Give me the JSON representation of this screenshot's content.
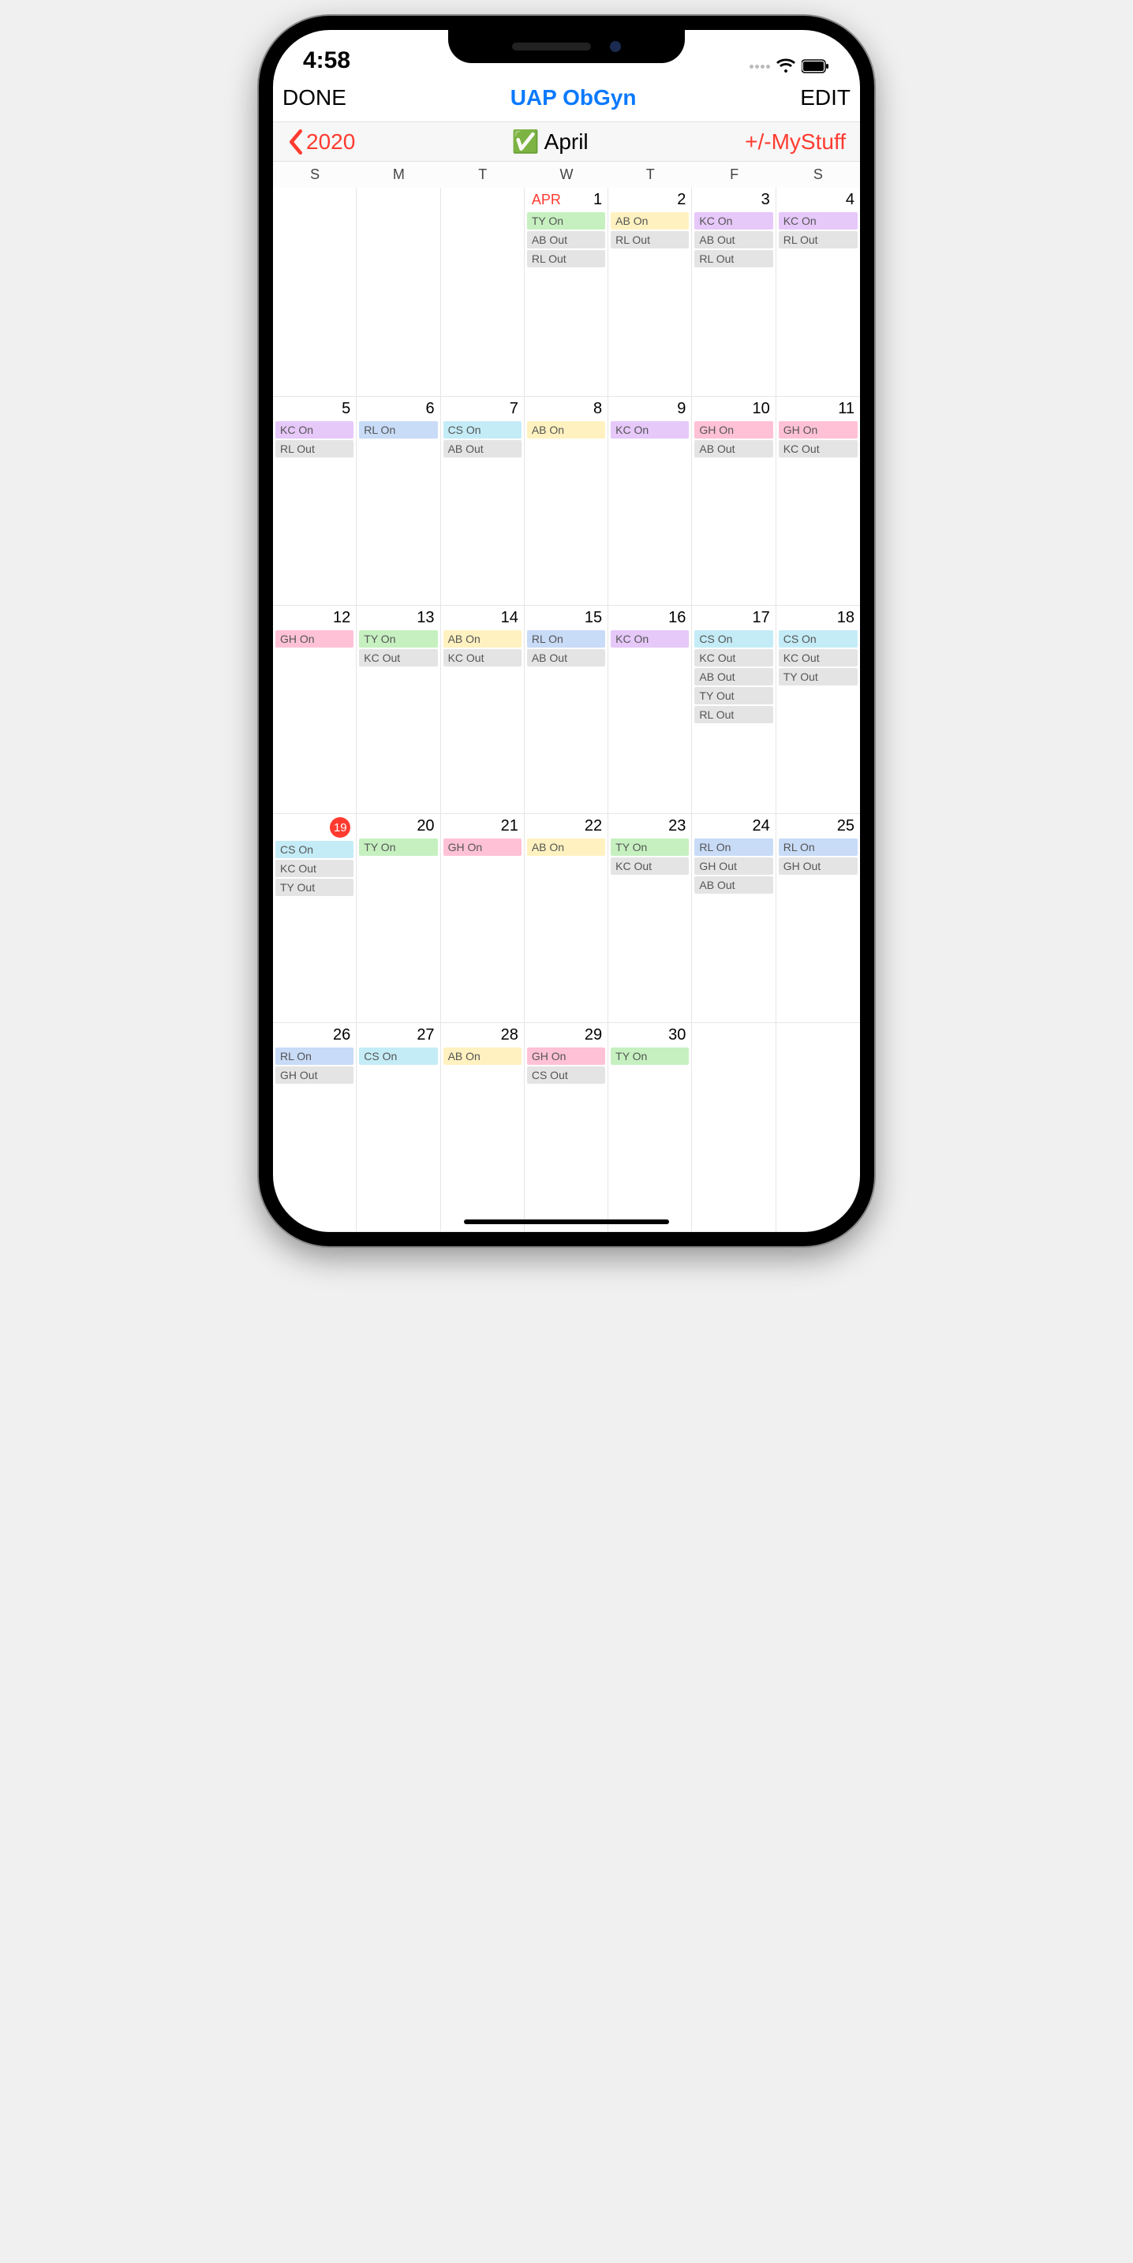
{
  "status_time": "4:58",
  "nav": {
    "left": "DONE",
    "title": "UAP ObGyn",
    "right": "EDIT"
  },
  "sub": {
    "back": "2020",
    "month": "April",
    "right": "+/-MyStuff",
    "check": "✅"
  },
  "day_headers": [
    "S",
    "M",
    "T",
    "W",
    "T",
    "F",
    "S"
  ],
  "month_abbr": "APR",
  "colors": {
    "KC": "c-purple",
    "TY": "c-green",
    "AB": "c-yellow",
    "RL": "c-blue",
    "CS": "c-cyan",
    "GH": "c-pink",
    "Out": "c-gray"
  },
  "weeks": [
    [
      {
        "d": "",
        "ev": []
      },
      {
        "d": "",
        "ev": []
      },
      {
        "d": "",
        "ev": []
      },
      {
        "d": "1",
        "first": true,
        "ev": [
          [
            "TY On",
            "c-green"
          ],
          [
            "AB Out",
            "c-gray"
          ],
          [
            "RL Out",
            "c-gray"
          ]
        ]
      },
      {
        "d": "2",
        "ev": [
          [
            "AB On",
            "c-yellow"
          ],
          [
            "RL Out",
            "c-gray"
          ]
        ]
      },
      {
        "d": "3",
        "ev": [
          [
            "KC On",
            "c-purple"
          ],
          [
            "AB Out",
            "c-gray"
          ],
          [
            "RL Out",
            "c-gray"
          ]
        ]
      },
      {
        "d": "4",
        "ev": [
          [
            "KC On",
            "c-purple"
          ],
          [
            "RL Out",
            "c-gray"
          ]
        ]
      }
    ],
    [
      {
        "d": "5",
        "ev": [
          [
            "KC On",
            "c-purple"
          ],
          [
            "RL Out",
            "c-gray"
          ]
        ]
      },
      {
        "d": "6",
        "ev": [
          [
            "RL On",
            "c-blue"
          ]
        ]
      },
      {
        "d": "7",
        "ev": [
          [
            "CS On",
            "c-cyan"
          ],
          [
            "AB Out",
            "c-gray"
          ]
        ]
      },
      {
        "d": "8",
        "ev": [
          [
            "AB On",
            "c-yellow"
          ]
        ]
      },
      {
        "d": "9",
        "ev": [
          [
            "KC On",
            "c-purple"
          ]
        ]
      },
      {
        "d": "10",
        "ev": [
          [
            "GH On",
            "c-pink"
          ],
          [
            "AB Out",
            "c-gray"
          ]
        ]
      },
      {
        "d": "11",
        "ev": [
          [
            "GH On",
            "c-pink"
          ],
          [
            "KC Out",
            "c-gray"
          ]
        ]
      }
    ],
    [
      {
        "d": "12",
        "ev": [
          [
            "GH On",
            "c-pink"
          ]
        ]
      },
      {
        "d": "13",
        "ev": [
          [
            "TY On",
            "c-green"
          ],
          [
            "KC Out",
            "c-gray"
          ]
        ]
      },
      {
        "d": "14",
        "ev": [
          [
            "AB On",
            "c-yellow"
          ],
          [
            "KC Out",
            "c-gray"
          ]
        ]
      },
      {
        "d": "15",
        "ev": [
          [
            "RL On",
            "c-blue"
          ],
          [
            "AB Out",
            "c-gray"
          ]
        ]
      },
      {
        "d": "16",
        "ev": [
          [
            "KC On",
            "c-purple"
          ]
        ]
      },
      {
        "d": "17",
        "ev": [
          [
            "CS On",
            "c-cyan"
          ],
          [
            "KC Out",
            "c-gray"
          ],
          [
            "AB Out",
            "c-gray"
          ],
          [
            "TY Out",
            "c-gray"
          ],
          [
            "RL Out",
            "c-gray"
          ]
        ]
      },
      {
        "d": "18",
        "ev": [
          [
            "CS On",
            "c-cyan"
          ],
          [
            "KC Out",
            "c-gray"
          ],
          [
            "TY Out",
            "c-gray"
          ]
        ]
      }
    ],
    [
      {
        "d": "19",
        "today": true,
        "ev": [
          [
            "CS On",
            "c-cyan"
          ],
          [
            "KC Out",
            "c-gray"
          ],
          [
            "TY Out",
            "c-gray"
          ]
        ]
      },
      {
        "d": "20",
        "ev": [
          [
            "TY On",
            "c-green"
          ]
        ]
      },
      {
        "d": "21",
        "ev": [
          [
            "GH On",
            "c-pink"
          ]
        ]
      },
      {
        "d": "22",
        "ev": [
          [
            "AB On",
            "c-yellow"
          ]
        ]
      },
      {
        "d": "23",
        "ev": [
          [
            "TY On",
            "c-green"
          ],
          [
            "KC Out",
            "c-gray"
          ]
        ]
      },
      {
        "d": "24",
        "ev": [
          [
            "RL On",
            "c-blue"
          ],
          [
            "GH Out",
            "c-gray"
          ],
          [
            "AB Out",
            "c-gray"
          ]
        ]
      },
      {
        "d": "25",
        "ev": [
          [
            "RL On",
            "c-blue"
          ],
          [
            "GH Out",
            "c-gray"
          ]
        ]
      }
    ],
    [
      {
        "d": "26",
        "ev": [
          [
            "RL On",
            "c-blue"
          ],
          [
            "GH Out",
            "c-gray"
          ]
        ]
      },
      {
        "d": "27",
        "ev": [
          [
            "CS On",
            "c-cyan"
          ]
        ]
      },
      {
        "d": "28",
        "ev": [
          [
            "AB On",
            "c-yellow"
          ]
        ]
      },
      {
        "d": "29",
        "ev": [
          [
            "GH On",
            "c-pink"
          ],
          [
            "CS Out",
            "c-gray"
          ]
        ]
      },
      {
        "d": "30",
        "ev": [
          [
            "TY On",
            "c-green"
          ]
        ]
      },
      {
        "d": "",
        "ev": []
      },
      {
        "d": "",
        "ev": []
      }
    ]
  ]
}
